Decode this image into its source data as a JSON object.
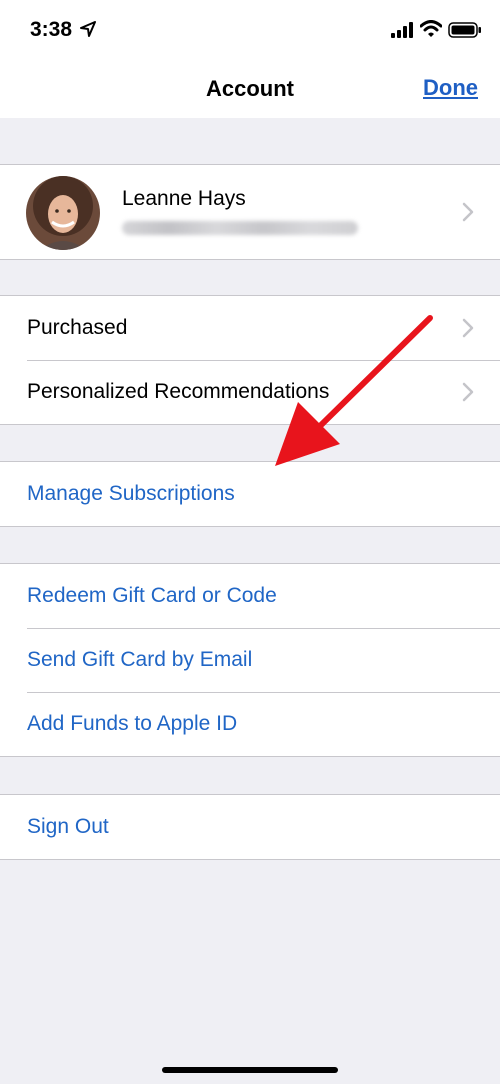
{
  "status_bar": {
    "time": "3:38"
  },
  "nav": {
    "title": "Account",
    "done_label": "Done"
  },
  "profile": {
    "name": "Leanne Hays"
  },
  "sections": {
    "purchases": [
      "Purchased",
      "Personalized Recommendations"
    ],
    "manage": [
      "Manage Subscriptions"
    ],
    "gift": [
      "Redeem Gift Card or Code",
      "Send Gift Card by Email",
      "Add Funds to Apple ID"
    ],
    "signout": [
      "Sign Out"
    ]
  },
  "colors": {
    "link_blue": "#2066c6",
    "annotation_red": "#e8141c",
    "group_background": "#efeff4"
  },
  "icons": {
    "location": "location-arrow-icon",
    "signal": "cellular-signal-icon",
    "wifi": "wifi-icon",
    "battery": "battery-icon",
    "chevron": "chevron-right-icon"
  }
}
